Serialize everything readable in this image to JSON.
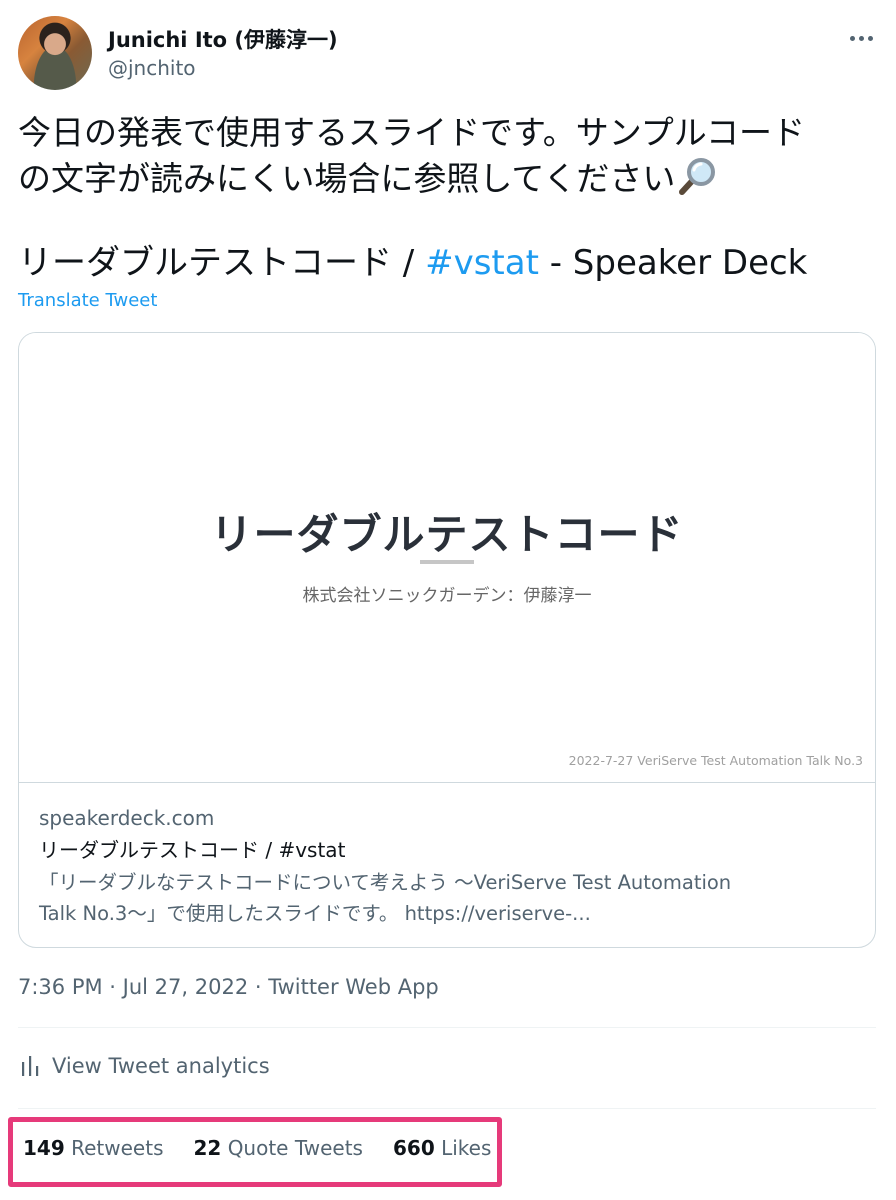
{
  "author": {
    "display_name": "Junichi Ito (伊藤淳一)",
    "username": "@jnchito",
    "avatar_icon": "avatar-photo"
  },
  "more_icon": "more-options-icon",
  "tweet": {
    "text_lines": [
      "今日の発表で使用するスライドです。サンプルコード",
      "の文字が読みにくい場合に参照してください"
    ],
    "emoji": "magnifying-glass-icon",
    "link_title_before": "リーダブルテストコード / ",
    "hashtag": "#vstat",
    "link_title_after": " - Speaker Deck",
    "translate": "Translate Tweet"
  },
  "card": {
    "slide": {
      "title": "リーダブルテストコード",
      "subtitle": "株式会社ソニックガーデン：伊藤淳一",
      "footer": "2022-7-27 VeriServe Test Automation Talk No.3"
    },
    "domain": "speakerdeck.com",
    "title": "リーダブルテストコード / #vstat",
    "description_lines": [
      "「リーダブルなテストコードについて考えよう 〜VeriServe Test Automation",
      "Talk No.3〜」で使用したスライドです。 https://veriserve-..."
    ]
  },
  "meta": {
    "time": "7:36 PM",
    "separator": " · ",
    "date": "Jul 27, 2022",
    "source": "Twitter Web App"
  },
  "analytics": {
    "label": "View Tweet analytics",
    "icon": "bar-chart-icon"
  },
  "stats": {
    "retweets_count": "149",
    "retweets_label": "Retweets",
    "quotes_count": "22",
    "quotes_label": "Quote Tweets",
    "likes_count": "660",
    "likes_label": "Likes"
  },
  "colors": {
    "accent": "#1d9bf0",
    "highlight": "#e63a7a",
    "secondary_text": "#536471"
  }
}
